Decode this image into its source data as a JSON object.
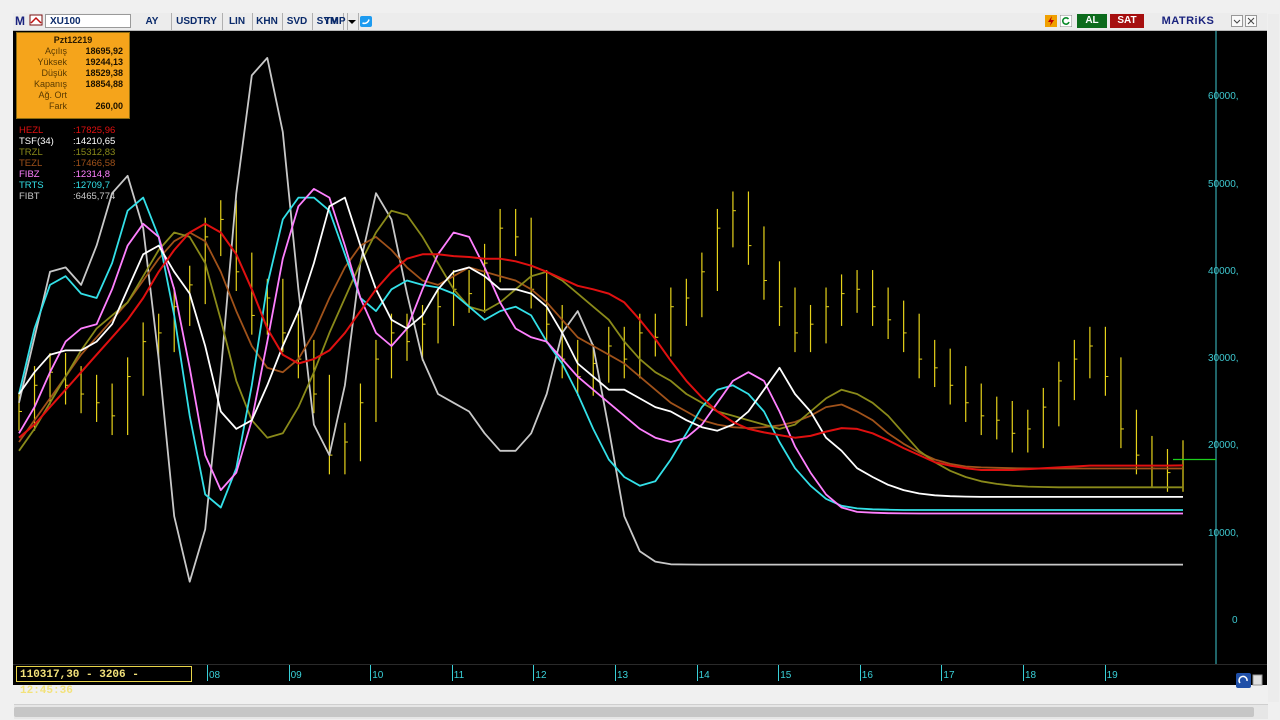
{
  "toolbar": {
    "app_icon": "M",
    "symbol": "XU100",
    "buttons": [
      "AY",
      "USDTRY",
      "LIN",
      "KHN",
      "SVD",
      "SYM",
      "TMP"
    ],
    "buy_label": "AL",
    "sell_label": "SAT",
    "brand": "MATRiKS"
  },
  "info": {
    "date": "Pzt12219",
    "rows": [
      {
        "label": "Açılış",
        "value": "18695,92"
      },
      {
        "label": "Yüksek",
        "value": "19244,13"
      },
      {
        "label": "Düşük",
        "value": "18529,38"
      },
      {
        "label": "Kapanış",
        "value": "18854,88"
      },
      {
        "label": "Ağ. Ort",
        "value": ""
      },
      {
        "label": "Fark",
        "value": "260,00"
      }
    ]
  },
  "legend": [
    {
      "name": "HEZL",
      "value": ":17825,96",
      "color": "#e01010"
    },
    {
      "name": "TSF(34)",
      "value": ":14210,65",
      "color": "#ffffff"
    },
    {
      "name": "TRZL",
      "value": ":15312,83",
      "color": "#8a8a1a"
    },
    {
      "name": "TEZL",
      "value": ":17466,58",
      "color": "#a0521a"
    },
    {
      "name": "FIBZ",
      "value": ":12314,8",
      "color": "#ff80ff"
    },
    {
      "name": "TRTS",
      "value": ":12709,7",
      "color": "#33e0e8"
    },
    {
      "name": "FIBT",
      "value": ":6465,774",
      "color": "#c8c8c8"
    }
  ],
  "status": "110317,30 - 3206 - 12:45:36",
  "y_axis_labels": [
    "60000,",
    "50000,",
    "40000,",
    "30000,",
    "20000,",
    "10000,",
    "0"
  ],
  "x_axis_labels": [
    "08",
    "09",
    "10",
    "11",
    "12",
    "13",
    "14",
    "15",
    "16",
    "17",
    "18",
    "19"
  ],
  "colors": {
    "price_bars": "#e6d21a",
    "axis": "#3ec8d0",
    "last_price_line": "#1ccf1c",
    "info_bg": "#f5a41b"
  },
  "chart_data": {
    "type": "line",
    "ylim": [
      0,
      65000
    ],
    "x": [
      0,
      4,
      8,
      12,
      16,
      20,
      24,
      28,
      32,
      36,
      40,
      44,
      48,
      52,
      56,
      60,
      64,
      68,
      72,
      76,
      80,
      84,
      88,
      92,
      96,
      100,
      104,
      108,
      112,
      116,
      120,
      124,
      128,
      132,
      136,
      140,
      144,
      148,
      152,
      156,
      160,
      164,
      168,
      172,
      176,
      180,
      184,
      188,
      192,
      196,
      200,
      204,
      208,
      212,
      216,
      220,
      224,
      228,
      232,
      236,
      240,
      244,
      248,
      252,
      256,
      260,
      264,
      268,
      272,
      276,
      280,
      284,
      288,
      292,
      296,
      300
    ],
    "price_close": [
      24000,
      27000,
      28500,
      27000,
      26000,
      25000,
      23500,
      28000,
      32000,
      33000,
      36000,
      38500,
      44000,
      46000,
      40000,
      35000,
      37000,
      33000,
      30000,
      26000,
      19000,
      20500,
      25000,
      30000,
      33000,
      32000,
      34000,
      36000,
      38000,
      37500,
      41000,
      45000,
      44000,
      38000,
      34000,
      30000,
      28000,
      29500,
      31500,
      30000,
      33000,
      32500,
      36000,
      37000,
      40000,
      45000,
      47000,
      43000,
      39000,
      36000,
      33000,
      34000,
      36000,
      37500,
      38000,
      36000,
      34500,
      33000,
      30000,
      29000,
      27000,
      25000,
      23500,
      23000,
      21500,
      22000,
      24500,
      27500,
      30000,
      31500,
      28000,
      22000,
      19000,
      17500,
      17000,
      18500
    ],
    "series": [
      {
        "name": "HEZL",
        "values": [
          21000,
          22500,
          24500,
          26500,
          28500,
          30500,
          32500,
          34500,
          37000,
          40000,
          42500,
          44500,
          45500,
          44500,
          42000,
          38000,
          33500,
          30500,
          29500,
          30000,
          31000,
          33000,
          35500,
          38000,
          40000,
          41500,
          42000,
          42000,
          41800,
          41700,
          41500,
          41500,
          41200,
          40700,
          40000,
          39200,
          38400,
          38000,
          37500,
          36500,
          34500,
          32300,
          29800,
          27500,
          25600,
          24000,
          22800,
          22000,
          21600,
          21300,
          21000,
          21200,
          21700,
          22100,
          22000,
          21500,
          20700,
          19800,
          19000,
          18200,
          17800,
          17500,
          17300,
          17300,
          17300,
          17400,
          17500,
          17600,
          17700,
          17800,
          17800,
          17800,
          17800,
          17800,
          17800,
          17825.96
        ]
      },
      {
        "name": "TSF(34)",
        "values": [
          26000,
          28500,
          30500,
          31000,
          31000,
          32000,
          34000,
          38000,
          42000,
          43000,
          40000,
          37500,
          31500,
          24000,
          22000,
          23000,
          27000,
          31500,
          35500,
          41000,
          47500,
          48500,
          43000,
          38000,
          34500,
          33500,
          35000,
          38000,
          40000,
          40500,
          39500,
          38000,
          38000,
          37500,
          36000,
          33000,
          29500,
          28000,
          26500,
          26500,
          25500,
          24500,
          24000,
          23000,
          22200,
          21800,
          22500,
          24000,
          26500,
          29000,
          26000,
          24000,
          21000,
          19500,
          17500,
          16500,
          15600,
          15000,
          14600,
          14400,
          14300,
          14250,
          14220,
          14210,
          14210,
          14210,
          14210,
          14210,
          14210,
          14210,
          14210,
          14210,
          14210,
          14210,
          14210,
          14210.65
        ]
      },
      {
        "name": "TRZL",
        "values": [
          19500,
          22000,
          25000,
          28000,
          31000,
          33500,
          35000,
          36500,
          39500,
          42500,
          44500,
          44000,
          41000,
          34500,
          27500,
          23000,
          21000,
          21500,
          24500,
          28500,
          33000,
          37000,
          41000,
          44500,
          47000,
          46500,
          44000,
          41000,
          38000,
          36000,
          35500,
          36500,
          38000,
          39500,
          40000,
          39000,
          37500,
          36000,
          34500,
          32000,
          30000,
          28500,
          27500,
          26000,
          25000,
          24000,
          23500,
          23000,
          22500,
          22000,
          22500,
          24000,
          25500,
          26500,
          26000,
          25000,
          23500,
          21500,
          19500,
          18200,
          17200,
          16500,
          16000,
          15700,
          15500,
          15400,
          15350,
          15320,
          15313,
          15313,
          15313,
          15313,
          15313,
          15313,
          15313,
          15312.83
        ]
      },
      {
        "name": "TEZL",
        "values": [
          20500,
          23000,
          25500,
          28000,
          30500,
          32500,
          34500,
          36500,
          39000,
          41500,
          43500,
          44500,
          43500,
          40000,
          35500,
          31500,
          29000,
          28500,
          30000,
          33000,
          37000,
          40500,
          43000,
          44000,
          42500,
          40500,
          39000,
          38500,
          39500,
          40500,
          40000,
          39500,
          39000,
          38000,
          36500,
          34500,
          32500,
          31500,
          30500,
          29500,
          28000,
          26500,
          25000,
          24000,
          23000,
          22500,
          22200,
          22100,
          22200,
          22400,
          22800,
          23500,
          24500,
          24800,
          24000,
          23000,
          21500,
          20300,
          19300,
          18500,
          18000,
          17700,
          17600,
          17550,
          17500,
          17480,
          17470,
          17467,
          17467,
          17467,
          17467,
          17467,
          17467,
          17467,
          17467,
          17466.58
        ]
      },
      {
        "name": "FIBZ",
        "values": [
          21500,
          24500,
          28500,
          32000,
          33500,
          34000,
          38000,
          43000,
          45500,
          44000,
          38000,
          29000,
          19000,
          15000,
          17000,
          23000,
          32000,
          41500,
          47500,
          49500,
          48500,
          43000,
          37000,
          33000,
          31500,
          33500,
          38000,
          42000,
          44500,
          44000,
          40500,
          36500,
          33500,
          32500,
          32000,
          30000,
          28000,
          26500,
          25000,
          23500,
          22000,
          21000,
          20500,
          21000,
          22500,
          25000,
          27500,
          28500,
          27500,
          24000,
          20000,
          17000,
          14500,
          13000,
          12500,
          12400,
          12350,
          12320,
          12315,
          12315,
          12315,
          12315,
          12315,
          12315,
          12315,
          12315,
          12315,
          12315,
          12315,
          12315,
          12315,
          12315,
          12315,
          12315,
          12315,
          12314.8
        ]
      },
      {
        "name": "TRTS",
        "values": [
          26000,
          33500,
          38500,
          39500,
          37500,
          37000,
          41000,
          47000,
          48500,
          44000,
          35000,
          23500,
          14500,
          13000,
          17500,
          27000,
          38500,
          46000,
          48500,
          48500,
          47000,
          42000,
          37000,
          35500,
          38000,
          39000,
          38500,
          38200,
          37500,
          36000,
          34500,
          35500,
          36000,
          35000,
          32000,
          29500,
          26000,
          22000,
          18500,
          16500,
          15500,
          16000,
          18500,
          21500,
          24500,
          26500,
          27000,
          26000,
          24000,
          20500,
          17500,
          15500,
          14000,
          13200,
          12900,
          12800,
          12750,
          12720,
          12712,
          12710,
          12710,
          12710,
          12710,
          12710,
          12710,
          12710,
          12710,
          12710,
          12710,
          12710,
          12710,
          12710,
          12710,
          12710,
          12710,
          12709.7
        ]
      },
      {
        "name": "FIBT",
        "values": [
          25000,
          32500,
          40000,
          40500,
          38500,
          43000,
          49000,
          51000,
          45000,
          30000,
          12000,
          4500,
          10500,
          28500,
          49000,
          62500,
          64500,
          56000,
          38000,
          22500,
          19000,
          27000,
          41000,
          49000,
          46000,
          37500,
          30000,
          26000,
          25000,
          24000,
          21500,
          19500,
          19500,
          21500,
          26000,
          33000,
          35500,
          31500,
          22000,
          12000,
          8000,
          6800,
          6500,
          6470,
          6466,
          6466,
          6466,
          6466,
          6466,
          6466,
          6466,
          6466,
          6466,
          6466,
          6466,
          6466,
          6466,
          6466,
          6466,
          6466,
          6466,
          6466,
          6466,
          6466,
          6466,
          6466,
          6466,
          6466,
          6466,
          6466,
          6466,
          6466,
          6466,
          6466,
          6466,
          6465.774
        ]
      }
    ]
  }
}
